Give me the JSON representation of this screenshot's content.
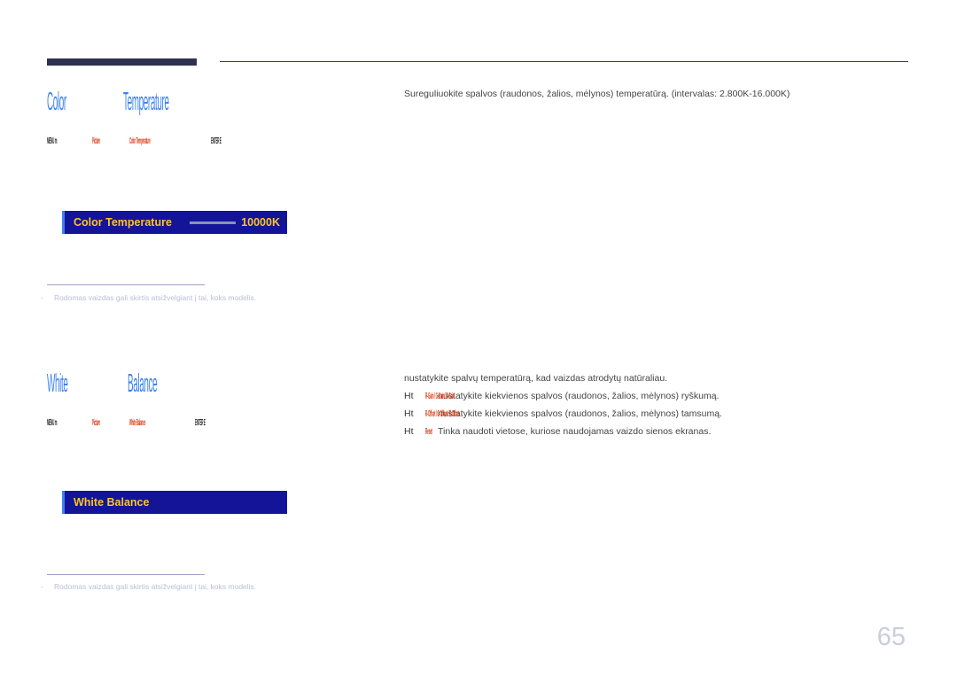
{
  "page": {
    "number": "65"
  },
  "sections": [
    {
      "heading": "Color Temperature",
      "heading_a": "Color",
      "heading_b": "Temperature",
      "breadcrumb": {
        "menu": "MENU m",
        "path1": "Picture",
        "path2": "Color Temperature",
        "enter": "ENTER E"
      },
      "osd": {
        "label": "Color Temperature",
        "value": "10000K",
        "has_slider": true
      },
      "description": "Sureguliuokite spalvos (raudonos, žalios, mėlynos) temperatūrą. (intervalas: 2.800K-16.000K)",
      "note": "Rodomas vaizdas gali skirtis atsižvelgiant į tai, koks modelis."
    },
    {
      "heading": "White Balance",
      "heading_a": "White",
      "heading_b": "Balance",
      "breadcrumb": {
        "menu": "MENU m",
        "path1": "Picture",
        "path2": "White Balance",
        "enter": "ENTER E"
      },
      "osd": {
        "label": "White Balance",
        "value": "",
        "has_slider": false
      },
      "description": "nustatykite spalvų temperatūrą, kad vaizdas atrodytų natūraliau.",
      "bullets": [
        {
          "marker": "Ht",
          "key": "R-Gain / G-Gain / B-Gain",
          "text": "nustatykite kiekvienos spalvos (raudonos, žalios, mėlynos) ryškumą."
        },
        {
          "marker": "Ht",
          "key": "R-Offset / G-Offset / B-Offset",
          "text": "nustatykite kiekvienos spalvos (raudonos, žalios, mėlynos) tamsumą."
        },
        {
          "marker": "Ht",
          "key": "Reset",
          "text": "Tinka naudoti vietose, kuriose naudojamas vaizdo sienos ekranas."
        }
      ],
      "note": "Rodomas vaizdas gali skirtis atsižvelgiant į tai, koks modelis."
    }
  ],
  "colors": {
    "heading": "#3d82f0",
    "osd_bg": "#141499",
    "osd_text": "#ffc425",
    "accent_red": "#d93b14",
    "rule_dark": "#2e3050",
    "note_text": "#b9c0d8"
  }
}
